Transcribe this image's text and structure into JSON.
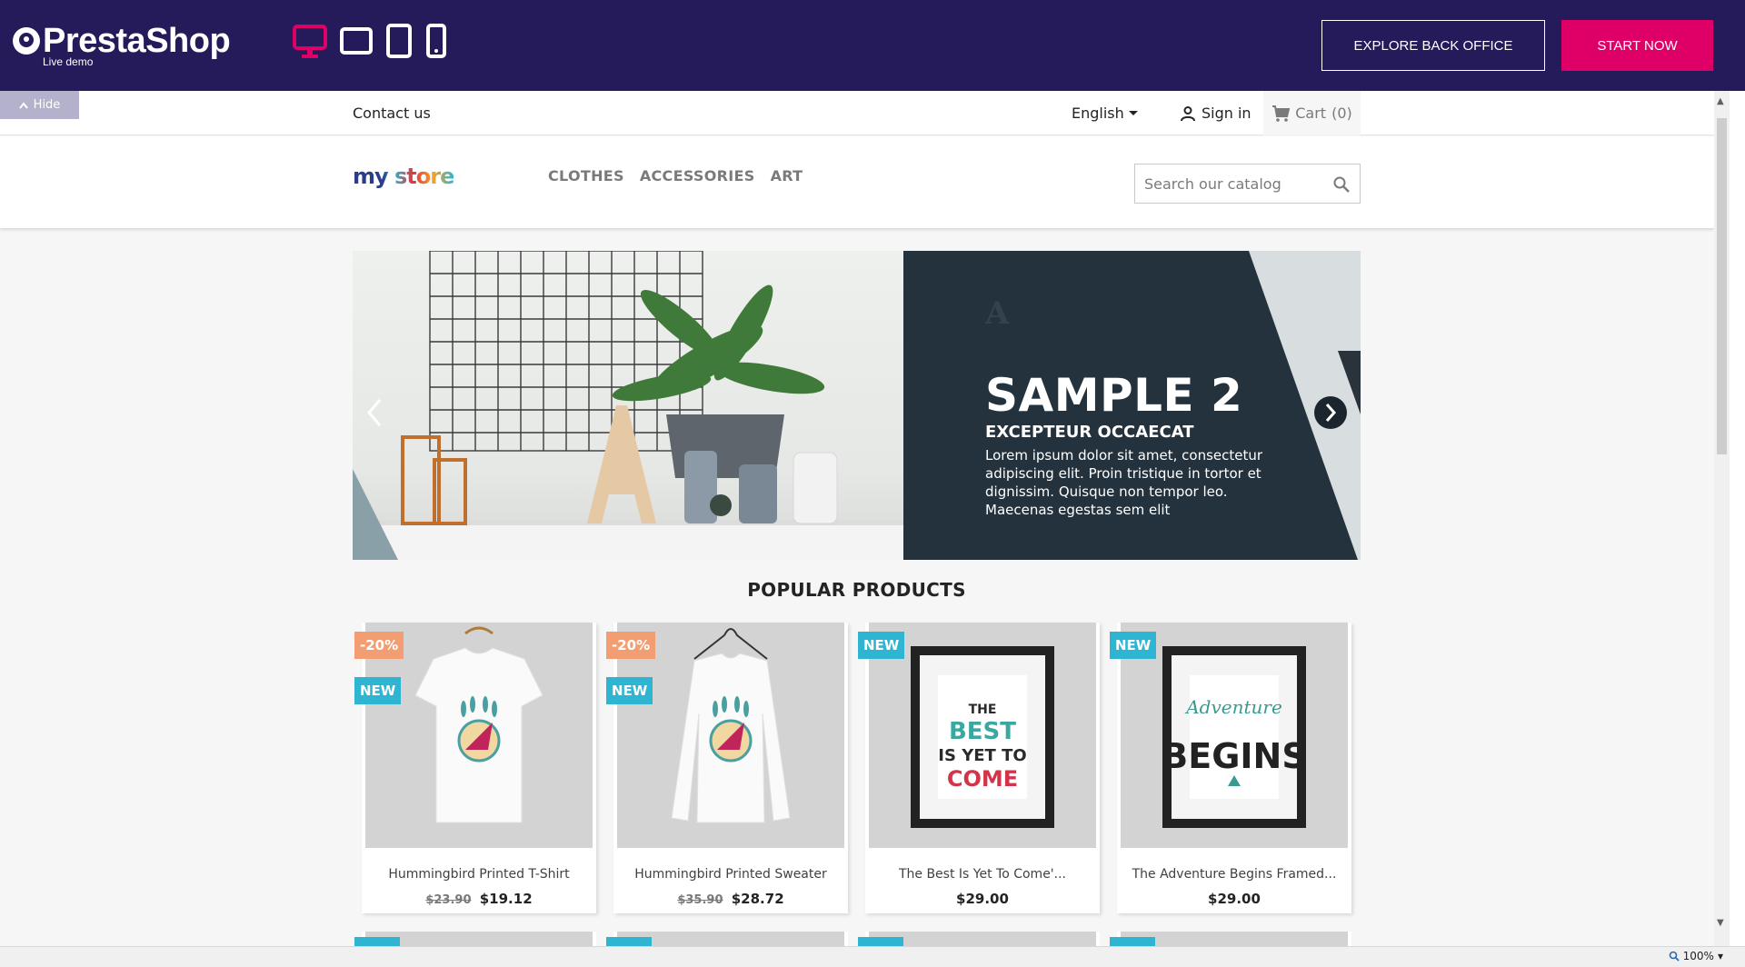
{
  "demo_bar": {
    "brand": "PrestaShop",
    "brand_sub": "Live demo",
    "devices": [
      {
        "icon": "desktop-icon",
        "active": true
      },
      {
        "icon": "tablet-landscape-icon",
        "active": false
      },
      {
        "icon": "tablet-portrait-icon",
        "active": false
      },
      {
        "icon": "mobile-icon",
        "active": false
      }
    ],
    "explore_label": "EXPLORE BACK OFFICE",
    "start_label": "START NOW",
    "hide_label": "Hide",
    "accent_color": "#df0067",
    "bar_color": "#251b5b"
  },
  "header_nav": {
    "contact": "Contact us",
    "language": "English",
    "signin": "Sign in",
    "cart": "Cart",
    "cart_count": "(0)"
  },
  "header_top": {
    "logo": "my store",
    "menu": [
      "CLOTHES",
      "ACCESSORIES",
      "ART"
    ],
    "search_placeholder": "Search our catalog"
  },
  "slider": {
    "title": "SAMPLE 2",
    "subtitle": "EXCEPTEUR OCCAECAT",
    "text": "Lorem ipsum dolor sit amet, consectetur adipiscing elit. Proin tristique in tortor et dignissim. Quisque non tempor leo. Maecenas egestas sem elit"
  },
  "popular": {
    "title": "POPULAR PRODUCTS",
    "products": [
      {
        "name": "Hummingbird Printed T-Shirt",
        "old_price": "$23.90",
        "price": "$19.12",
        "discount": "-20%",
        "new": "NEW"
      },
      {
        "name": "Hummingbird Printed Sweater",
        "old_price": "$35.90",
        "price": "$28.72",
        "discount": "-20%",
        "new": "NEW"
      },
      {
        "name": "The Best Is Yet To Come'...",
        "price": "$29.00",
        "new": "NEW"
      },
      {
        "name": "The Adventure Begins Framed...",
        "price": "$29.00",
        "new": "NEW"
      }
    ]
  },
  "status_bar": {
    "zoom": "100%"
  }
}
